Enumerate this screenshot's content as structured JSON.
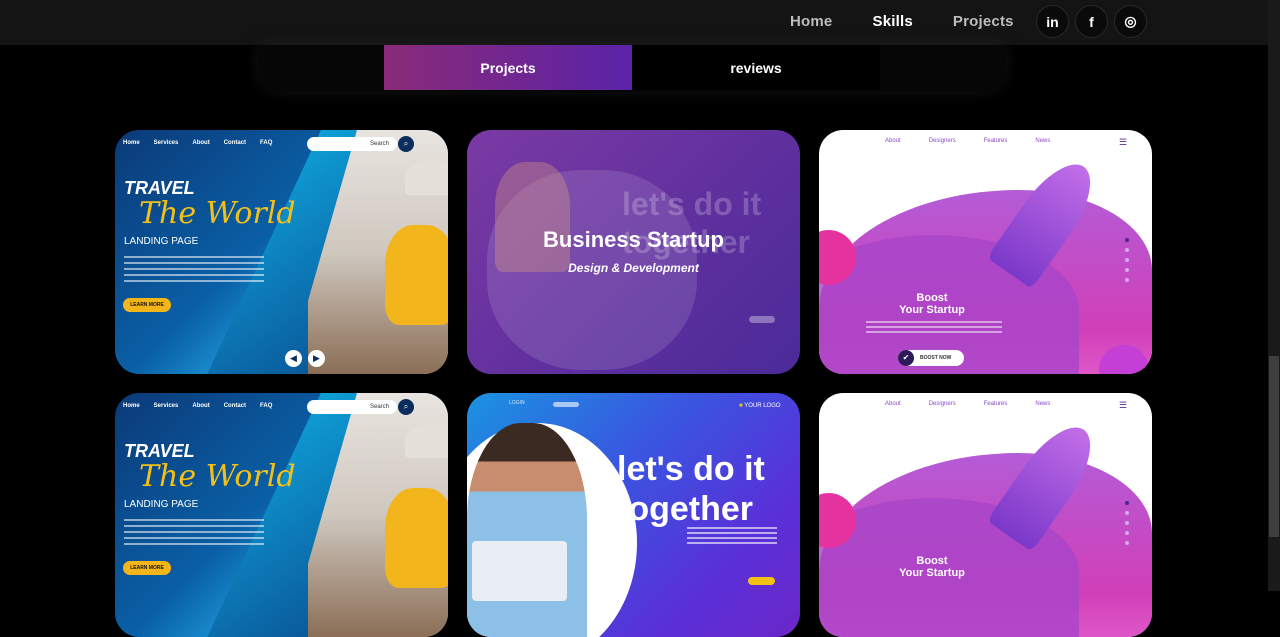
{
  "nav": {
    "links": [
      "Home",
      "Skills",
      "Projects"
    ],
    "active": "Skills",
    "social": [
      "linkedin-icon",
      "facebook-icon",
      "instagram-icon"
    ],
    "social_glyphs": [
      "in",
      "f",
      "◎"
    ]
  },
  "tabs": {
    "projects": "Projects",
    "reviews": "reviews",
    "active": "Projects"
  },
  "cards": {
    "travel": {
      "nav": [
        "Home",
        "Services",
        "About",
        "Contact",
        "FAQ"
      ],
      "search": "Search",
      "line1": "TRAVEL",
      "line2": "The World",
      "line3": "LANDING PAGE",
      "button": "LEARN MORE"
    },
    "business": {
      "title": "Business Startup",
      "subtitle": "Design & Development",
      "ghost": "let's do it together"
    },
    "boost": {
      "nav": [
        "About",
        "Designers",
        "Features",
        "News"
      ],
      "line1": "Boost",
      "line2": "Your Startup",
      "button": "BOOST NOW"
    },
    "together": {
      "nav": "LOGIN",
      "logo": "YOUR LOGO",
      "headline1": "let's do it",
      "headline2": "together"
    }
  },
  "colors": {
    "tab_gradient_start": "#8a2a78",
    "tab_gradient_end": "#5a23a8",
    "topbar": "#141414"
  }
}
